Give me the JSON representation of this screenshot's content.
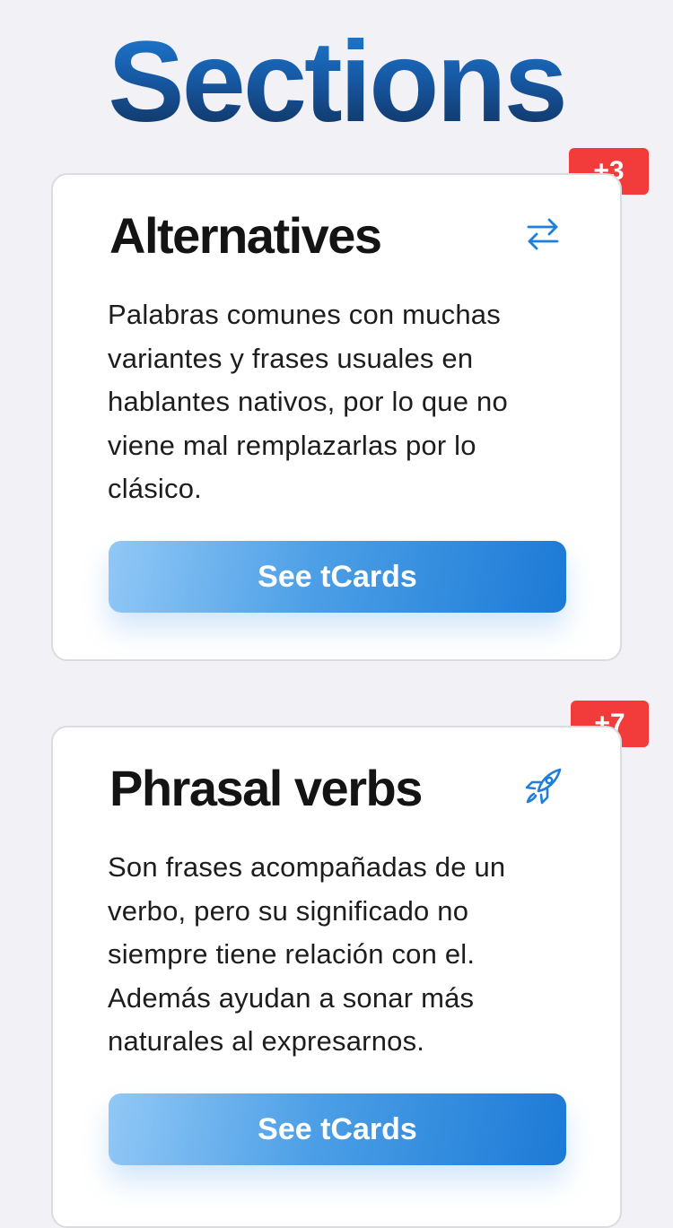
{
  "page": {
    "title": "Sections"
  },
  "sections": [
    {
      "title": "Alternatives",
      "icon": "swap-arrows-icon",
      "badge": "+3",
      "description": "Palabras comunes con muchas variantes y frases usuales en hablantes nativos, por lo que no viene mal remplazarlas por lo clásico.",
      "button_label": "See tCards"
    },
    {
      "title": "Phrasal verbs",
      "icon": "rocket-icon",
      "badge": "+7",
      "description": "Son frases acompañadas de un verbo, pero su significado no siempre tiene relación con el. Además ayudan a sonar más naturales al expresarnos.",
      "button_label": "See tCards"
    }
  ],
  "colors": {
    "accent": "#1c7ad6",
    "badge": "#f23b3b",
    "background": "#f1f1f6"
  }
}
